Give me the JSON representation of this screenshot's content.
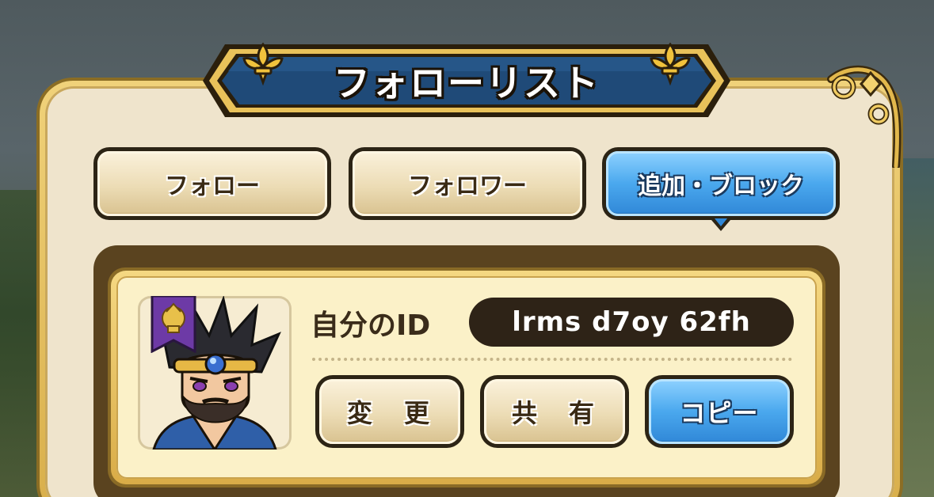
{
  "header": {
    "title": "フォローリスト"
  },
  "tabs": [
    {
      "label": "フォロー",
      "selected": false
    },
    {
      "label": "フォロワー",
      "selected": false
    },
    {
      "label": "追加・ブロック",
      "selected": true
    }
  ],
  "profile": {
    "id_label": "自分のID",
    "id_value": "lrms d7oy 62fh",
    "avatar_icon": "hero-portrait-icon",
    "badge_icon": "purple-rank-banner-icon",
    "buttons": {
      "change": "変　更",
      "share": "共　有",
      "copy": "コピー"
    }
  },
  "colors": {
    "accent_blue": "#4aa8ee",
    "banner_blue": "#1f4a78",
    "gold_frame": "#d9ac47",
    "panel_cream": "#efe4cc",
    "id_pill": "#2e2317"
  }
}
